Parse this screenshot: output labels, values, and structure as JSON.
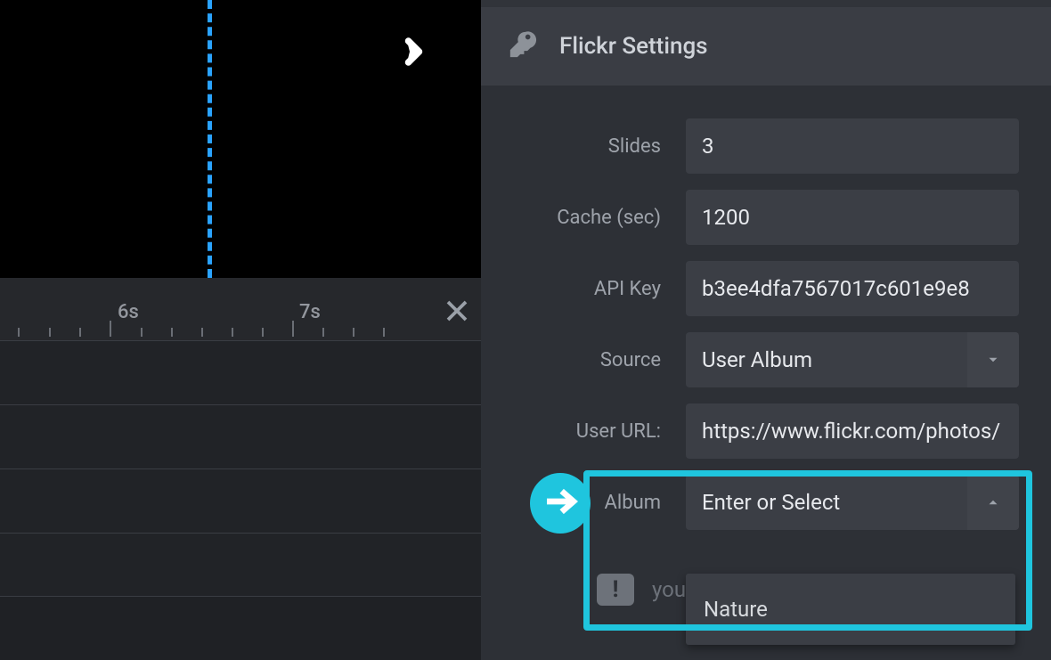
{
  "panel": {
    "title": "Flickr Settings"
  },
  "form": {
    "slides": {
      "label": "Slides",
      "value": "3"
    },
    "cache": {
      "label": "Cache (sec)",
      "value": "1200"
    },
    "apikey": {
      "label": "API Key",
      "value": "b3ee4dfa7567017c601e9e8"
    },
    "source": {
      "label": "Source",
      "value": "User Album"
    },
    "userurl": {
      "label": "User URL:",
      "value": "https://www.flickr.com/photos/"
    },
    "album": {
      "label": "Album",
      "placeholder": "Enter or Select"
    }
  },
  "dropdown": {
    "items": [
      "Nature"
    ]
  },
  "warning": {
    "text": "your Flickr API key"
  },
  "timeline": {
    "labels": [
      "6s",
      "7s"
    ]
  }
}
